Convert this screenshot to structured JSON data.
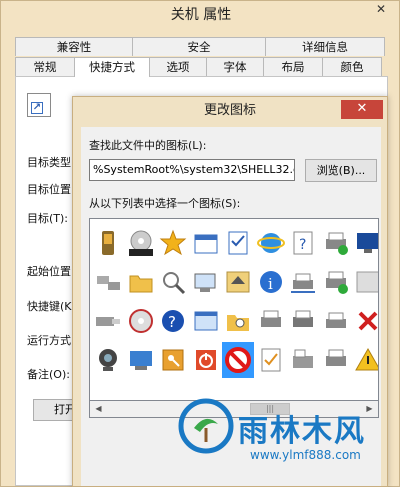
{
  "window": {
    "title": "关机 属性",
    "close_glyph": "✕"
  },
  "tabs_row1": [
    "兼容性",
    "安全",
    "详细信息"
  ],
  "tabs_row2": [
    "常规",
    "快捷方式",
    "选项",
    "字体",
    "布局",
    "颜色"
  ],
  "active_tab": "快捷方式",
  "fields": {
    "target_type": "目标类型",
    "target_location": "目标位置",
    "target": "目标(T):",
    "start_in": "起始位置",
    "shortcut_key": "快捷键(K",
    "run": "运行方式",
    "comment": "备注(O):",
    "open_button": "打开"
  },
  "dialog": {
    "title": "更改图标",
    "close_glyph": "✕",
    "find_label": "查找此文件中的图标(L):",
    "path_value": "%SystemRoot%\\system32\\SHELL32.dll",
    "browse_label": "浏览(B)...",
    "select_label": "从以下列表中选择一个图标(S):",
    "selected_icon": "no-entry"
  },
  "icons": [
    [
      "pda",
      "dvd-rw",
      "star",
      "calendar-files",
      "checklist",
      "internet-explorer",
      "help-document",
      "printer-green",
      "monitor-settings"
    ],
    [
      "usb-drives",
      "folder",
      "magnifier",
      "desktop-settings",
      "eject",
      "info",
      "network-printer",
      "printer-pause",
      "cut-off"
    ],
    [
      "usb-device",
      "cd-audio",
      "help-circle",
      "window-frame",
      "search-folder",
      "printer-2",
      "printer-3",
      "network-printer-2",
      "delete-red"
    ],
    [
      "webcam",
      "display-settings",
      "key",
      "power",
      "no-entry",
      "checklist-file",
      "fax-machine",
      "printer-4",
      "warning"
    ]
  ],
  "scrollbar": {
    "left_glyph": "◀",
    "right_glyph": "▶",
    "thumb_glyph": "|||"
  },
  "watermark": {
    "text": "雨林木风",
    "url": "www.ylmf888.com"
  },
  "colors": {
    "accent": "#3399ff",
    "close_red": "#c7453a",
    "watermark_blue": "#1a79c4"
  }
}
